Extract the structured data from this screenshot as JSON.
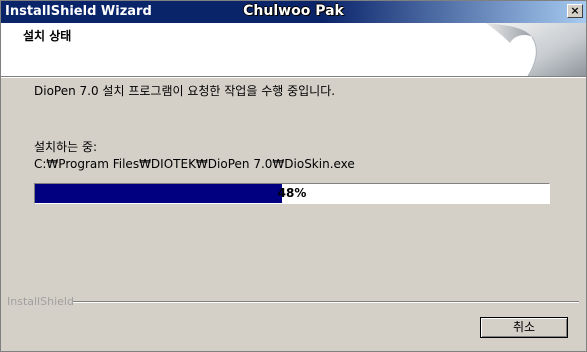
{
  "window": {
    "title": "InstallShield Wizard",
    "overlay_text": "Chulwoo Pak",
    "close_label": "×"
  },
  "header": {
    "title": "설치 상태"
  },
  "main": {
    "message": "DioPen 7.0 설치 프로그램이 요청한 작업을 수행 중입니다.",
    "status_label": "설치하는 중:",
    "current_file": "C:₩Program Files₩DIOTEK₩DioPen 7.0₩DioSkin.exe",
    "progress_percent": 48,
    "progress_text": "48%"
  },
  "footer": {
    "brand": "InstallShield",
    "cancel_label": "취소"
  },
  "colors": {
    "title_bar": "#0a246a",
    "progress_fill": "#000080",
    "dialog_bg": "#d4d0c8"
  }
}
